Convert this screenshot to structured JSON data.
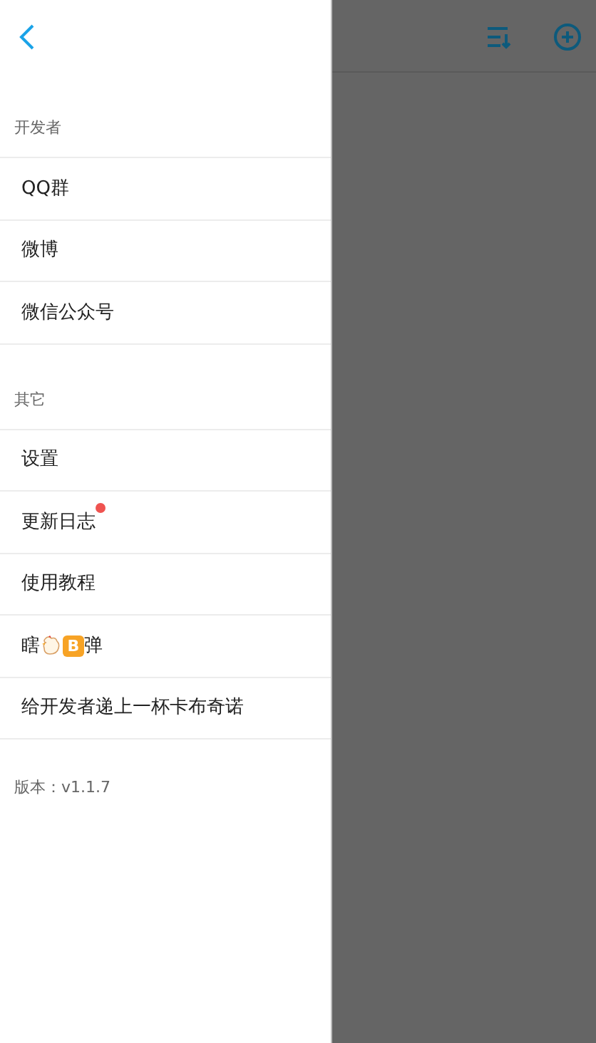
{
  "sections": [
    {
      "title": "开发者",
      "items": [
        {
          "kind": "text",
          "label": "QQ群",
          "badge_dot": false
        },
        {
          "kind": "text",
          "label": "微博",
          "badge_dot": false
        },
        {
          "kind": "text",
          "label": "微信公众号",
          "badge_dot": false
        }
      ]
    },
    {
      "title": "其它",
      "items": [
        {
          "kind": "text",
          "label": "设置",
          "badge_dot": false
        },
        {
          "kind": "text",
          "label": "更新日志",
          "badge_dot": true
        },
        {
          "kind": "text",
          "label": "使用教程",
          "badge_dot": false
        },
        {
          "kind": "emoji",
          "before": "瞎",
          "letter": "B",
          "after": "弹",
          "badge_dot": false
        },
        {
          "kind": "text",
          "label": "给开发者递上一杯卡布奇诺",
          "badge_dot": false
        }
      ]
    }
  ],
  "version": "版本：v1.1.7"
}
